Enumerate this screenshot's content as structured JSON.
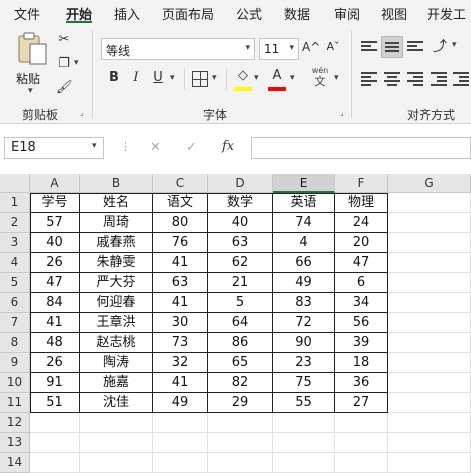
{
  "ribbon_tabs": [
    "文件",
    "开始",
    "插入",
    "页面布局",
    "公式",
    "数据",
    "审阅",
    "视图",
    "开发工"
  ],
  "active_tab": "开始",
  "clipboard": {
    "paste_label": "粘贴板",
    "group_label": "剪贴板",
    "paste_button": "粘贴"
  },
  "font": {
    "name": "等线",
    "size": "11",
    "group_label": "字体",
    "bold": "B",
    "italic": "I",
    "underline": "U",
    "grow": "A^",
    "shrink": "Aˇ",
    "phonetic_top": "wén",
    "phonetic_bottom": "文",
    "font_color_letter": "A"
  },
  "alignment": {
    "group_label": "对齐方式"
  },
  "colors": {
    "accent": "#217346",
    "highlight": "#ffff00",
    "font_color": "#ff0000"
  },
  "formula_bar": {
    "name_box": "E18",
    "cancel": "✕",
    "enter": "✓",
    "fx": "fx",
    "value": ""
  },
  "columns": [
    "A",
    "B",
    "C",
    "D",
    "E",
    "F",
    "G"
  ],
  "selected_column": "E",
  "rows": [
    "1",
    "2",
    "3",
    "4",
    "5",
    "6",
    "7",
    "8",
    "9",
    "10",
    "11",
    "12",
    "13",
    "14"
  ],
  "table": [
    [
      "学号",
      "姓名",
      "语文",
      "数学",
      "英语",
      "物理"
    ],
    [
      "57",
      "周琦",
      "80",
      "40",
      "74",
      "24"
    ],
    [
      "40",
      "戚春燕",
      "76",
      "63",
      "4",
      "20"
    ],
    [
      "26",
      "朱静雯",
      "41",
      "62",
      "66",
      "47"
    ],
    [
      "47",
      "严大芬",
      "63",
      "21",
      "49",
      "6"
    ],
    [
      "84",
      "何迎春",
      "41",
      "5",
      "83",
      "34"
    ],
    [
      "41",
      "王章洪",
      "30",
      "64",
      "72",
      "56"
    ],
    [
      "48",
      "赵志桃",
      "73",
      "86",
      "90",
      "39"
    ],
    [
      "26",
      "陶涛",
      "32",
      "65",
      "23",
      "18"
    ],
    [
      "91",
      "施嘉",
      "41",
      "82",
      "75",
      "36"
    ],
    [
      "51",
      "沈佳",
      "49",
      "29",
      "55",
      "27"
    ]
  ]
}
